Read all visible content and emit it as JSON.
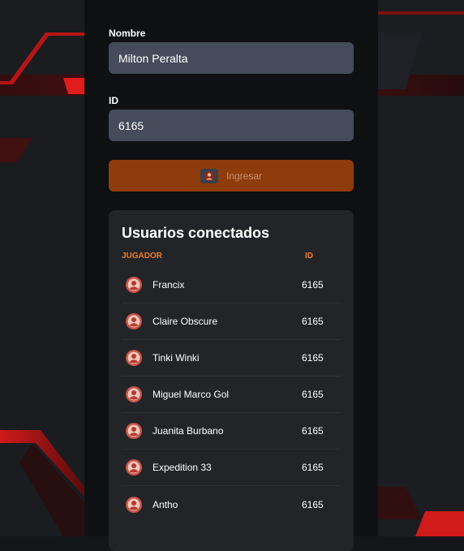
{
  "colors": {
    "accent_orange": "#8f3c0c",
    "header_orange": "#f07e22",
    "input_bg": "#454b5a",
    "card_bg": "#232427",
    "red_stripe": "#d11a1a"
  },
  "form": {
    "name_label": "Nombre",
    "name_value": "Milton Peralta",
    "id_label": "ID",
    "id_value": "6165",
    "submit_label": "Ingresar",
    "submit_icon": "user-circle-icon"
  },
  "users": {
    "title": "Usuarios conectados",
    "col_player": "JUGADOR",
    "col_id": "ID",
    "avatar_icon": "avatar-icon",
    "rows": [
      {
        "name": "Francix",
        "id": "6165"
      },
      {
        "name": "Claire Obscure",
        "id": "6165"
      },
      {
        "name": "Tinki Winki",
        "id": "6165"
      },
      {
        "name": "Miguel Marco Gol",
        "id": "6165"
      },
      {
        "name": "Juanita Burbano",
        "id": "6165"
      },
      {
        "name": "Expedition 33",
        "id": "6165"
      },
      {
        "name": "Antho",
        "id": "6165"
      }
    ]
  }
}
